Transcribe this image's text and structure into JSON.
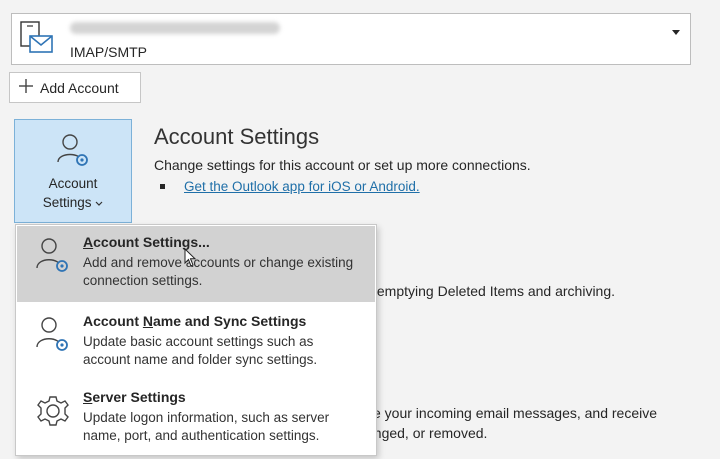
{
  "account_selector": {
    "account_type": "IMAP/SMTP"
  },
  "add_account": {
    "label": "Add Account"
  },
  "account_settings_button": {
    "line1": "Account",
    "line2": "Settings"
  },
  "section": {
    "title": "Account Settings",
    "description": "Change settings for this account or set up more connections.",
    "link": "Get the Outlook app for iOS or Android."
  },
  "background_text": {
    "line1": "y emptying Deleted Items and archiving.",
    "line2": "ze your incoming email messages, and receive",
    "line3": "anged, or removed."
  },
  "menu": {
    "items": [
      {
        "title": {
          "pre": "",
          "accel": "A",
          "post": "ccount Settings..."
        },
        "desc": "Add and remove accounts or change existing connection settings."
      },
      {
        "title": {
          "pre": "Account ",
          "accel": "N",
          "post": "ame and Sync Settings"
        },
        "desc": "Update basic account settings such as account name and folder sync settings."
      },
      {
        "title": {
          "pre": "",
          "accel": "S",
          "post": "erver Settings"
        },
        "desc": "Update logon information, such as server name, port, and authentication settings."
      }
    ]
  },
  "colors": {
    "accent_icon": "#2f74b5",
    "link": "#1f6fa8",
    "button_selected_bg": "#cce4f7",
    "menu_highlight_bg": "#d2d2d2"
  },
  "icons": {
    "account_icon": "mailbox-icon",
    "add_icon": "plus-icon",
    "settings_icon": "user-gear-icon",
    "server_icon": "gear-icon"
  }
}
